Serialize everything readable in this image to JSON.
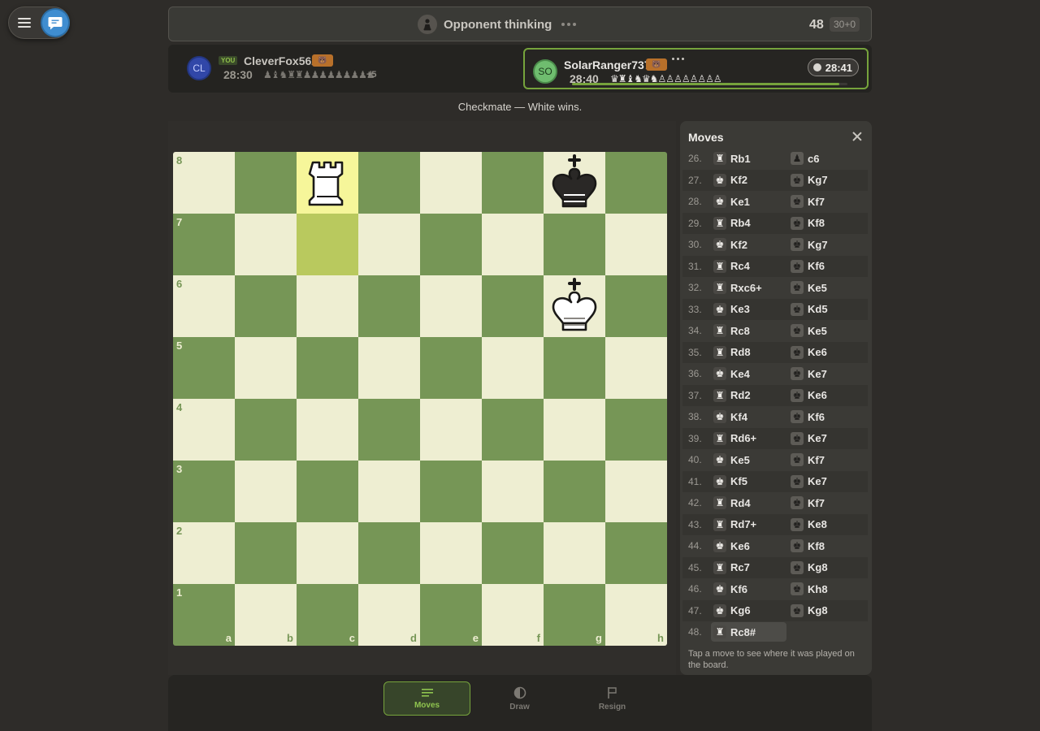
{
  "status": {
    "text": "Opponent thinking",
    "move_number": "48",
    "time_control": "30+0"
  },
  "players": {
    "me": {
      "avatar": "CL",
      "you_label": "YOU",
      "name": "CleverFox562",
      "clock": "28:30",
      "captured": "♟♝♞♜♜♟♟♟♟♟♟♟♟♟",
      "advantage": "+5"
    },
    "opponent": {
      "avatar": "SO",
      "name": "SolarRanger737",
      "clock": "28:40",
      "captured": "♛♜♝♞♛♞♙♙♙♙♙♙♙♙",
      "turn_timer": "28:41",
      "turn_progress_percent": 97
    }
  },
  "result": "Checkmate — White wins.",
  "board": {
    "files": [
      "a",
      "b",
      "c",
      "d",
      "e",
      "f",
      "g",
      "h"
    ],
    "ranks": [
      "8",
      "7",
      "6",
      "5",
      "4",
      "3",
      "2",
      "1"
    ],
    "highlight": [
      "c8",
      "c7"
    ],
    "pieces": [
      {
        "square": "c8",
        "piece": "white-rook-icon",
        "color": "white",
        "type": "rook"
      },
      {
        "square": "g8",
        "piece": "black-king-icon",
        "color": "black",
        "type": "king"
      },
      {
        "square": "g6",
        "piece": "white-king-icon",
        "color": "white",
        "type": "king"
      }
    ],
    "light_color": "#eeeed2",
    "dark_color": "#769656"
  },
  "moves_panel": {
    "title": "Moves",
    "hint": "Tap a move to see where it was played on the board.",
    "moves": [
      {
        "num": "26.",
        "white": "Rb1",
        "white_icon": "rook",
        "black": "c6",
        "black_icon": "pawn"
      },
      {
        "num": "27.",
        "white": "Kf2",
        "white_icon": "king",
        "black": "Kg7",
        "black_icon": "king"
      },
      {
        "num": "28.",
        "white": "Ke1",
        "white_icon": "king",
        "black": "Kf7",
        "black_icon": "king"
      },
      {
        "num": "29.",
        "white": "Rb4",
        "white_icon": "rook",
        "black": "Kf8",
        "black_icon": "king"
      },
      {
        "num": "30.",
        "white": "Kf2",
        "white_icon": "king",
        "black": "Kg7",
        "black_icon": "king"
      },
      {
        "num": "31.",
        "white": "Rc4",
        "white_icon": "rook",
        "black": "Kf6",
        "black_icon": "king"
      },
      {
        "num": "32.",
        "white": "Rxc6+",
        "white_icon": "rook",
        "black": "Ke5",
        "black_icon": "king"
      },
      {
        "num": "33.",
        "white": "Ke3",
        "white_icon": "king",
        "black": "Kd5",
        "black_icon": "king"
      },
      {
        "num": "34.",
        "white": "Rc8",
        "white_icon": "rook",
        "black": "Ke5",
        "black_icon": "king"
      },
      {
        "num": "35.",
        "white": "Rd8",
        "white_icon": "rook",
        "black": "Ke6",
        "black_icon": "king"
      },
      {
        "num": "36.",
        "white": "Ke4",
        "white_icon": "king",
        "black": "Ke7",
        "black_icon": "king"
      },
      {
        "num": "37.",
        "white": "Rd2",
        "white_icon": "rook",
        "black": "Ke6",
        "black_icon": "king"
      },
      {
        "num": "38.",
        "white": "Kf4",
        "white_icon": "king",
        "black": "Kf6",
        "black_icon": "king"
      },
      {
        "num": "39.",
        "white": "Rd6+",
        "white_icon": "rook",
        "black": "Ke7",
        "black_icon": "king"
      },
      {
        "num": "40.",
        "white": "Ke5",
        "white_icon": "king",
        "black": "Kf7",
        "black_icon": "king"
      },
      {
        "num": "41.",
        "white": "Kf5",
        "white_icon": "king",
        "black": "Ke7",
        "black_icon": "king"
      },
      {
        "num": "42.",
        "white": "Rd4",
        "white_icon": "rook",
        "black": "Kf7",
        "black_icon": "king"
      },
      {
        "num": "43.",
        "white": "Rd7+",
        "white_icon": "rook",
        "black": "Ke8",
        "black_icon": "king"
      },
      {
        "num": "44.",
        "white": "Ke6",
        "white_icon": "king",
        "black": "Kf8",
        "black_icon": "king"
      },
      {
        "num": "45.",
        "white": "Rc7",
        "white_icon": "rook",
        "black": "Kg8",
        "black_icon": "king"
      },
      {
        "num": "46.",
        "white": "Kf6",
        "white_icon": "king",
        "black": "Kh8",
        "black_icon": "king"
      },
      {
        "num": "47.",
        "white": "Kg6",
        "white_icon": "king",
        "black": "Kg8",
        "black_icon": "king"
      },
      {
        "num": "48.",
        "white": "Rc8#",
        "white_icon": "rook",
        "black": "",
        "black_icon": "",
        "current": true
      }
    ]
  },
  "bottom_nav": [
    {
      "label": "Moves",
      "icon": "list-icon",
      "active": true
    },
    {
      "label": "Draw",
      "icon": "half-circle-icon",
      "active": false
    },
    {
      "label": "Resign",
      "icon": "flag-icon",
      "active": false
    }
  ],
  "colors": {
    "accent": "#76a33c",
    "chat": "#3f8dd0"
  }
}
